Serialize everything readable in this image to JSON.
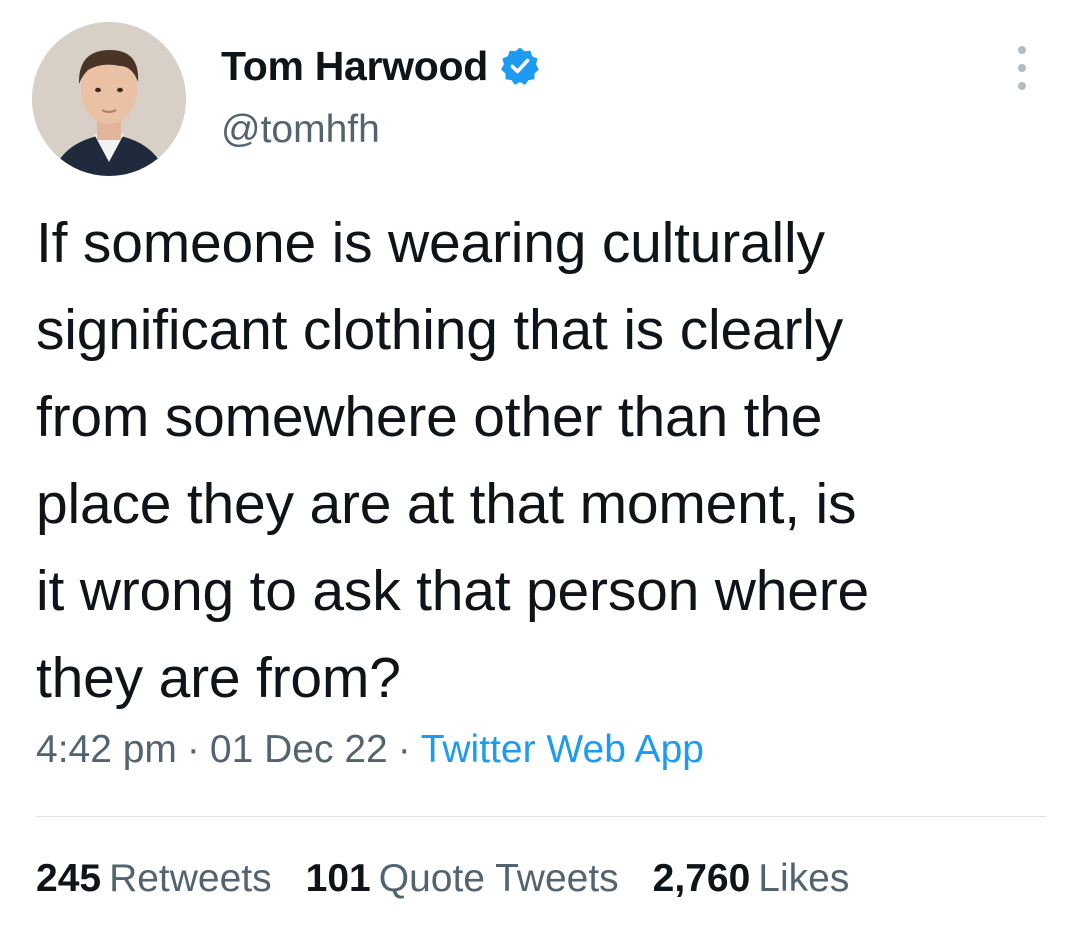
{
  "author": {
    "display_name": "Tom Harwood",
    "handle": "@tomhfh",
    "verified": true,
    "avatar_icon": "profile-photo"
  },
  "tweet": {
    "text_lines": [
      "If someone is wearing culturally",
      "significant clothing that is clearly",
      "from somewhere other than the",
      "place they are at that moment, is",
      "it wrong to ask that person where",
      "they are from?"
    ],
    "time": "4:42 pm",
    "date": "01 Dec 22",
    "separator": "·",
    "source": "Twitter Web App"
  },
  "stats": {
    "retweets": {
      "count": "245",
      "label": "Retweets"
    },
    "quotes": {
      "count": "101",
      "label": "Quote Tweets"
    },
    "likes": {
      "count": "2,760",
      "label": "Likes"
    }
  },
  "icons": {
    "verified_badge": "verified-badge-icon",
    "more": "more-options-icon"
  },
  "colors": {
    "text_primary": "#0f1419",
    "text_secondary": "#536471",
    "accent": "#1d9bf0"
  }
}
